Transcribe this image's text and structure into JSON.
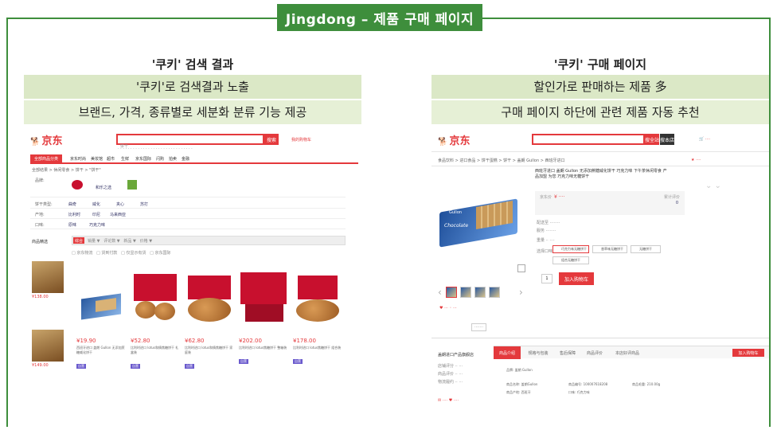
{
  "frame_title": "Jingdong – 제품 구매 페이지",
  "colors": {
    "frame_green": "#3e8e3c",
    "band1": "#dbe8c6",
    "band2": "#e6f0d6",
    "jd_red": "#e4393c"
  },
  "left": {
    "heading": "'쿠키' 검색 결과",
    "band1": "'쿠키'로 검색결과 노출",
    "band2": "브랜드, 가격, 종류별로 세분화 분류 기능 제공",
    "shot": {
      "logo": "京东",
      "search_value": "饼干",
      "search_button": "搜索",
      "cart": "我的购物车",
      "nav_highlight": "全部商品分类",
      "nav_items": [
        "京东时尚",
        "美妆馆",
        "超市",
        "生鲜",
        "京东国际",
        "闪购",
        "拍卖",
        "金融"
      ],
      "breadcrumb": "全部结果 > 休闲零食 > 饼干 > \"饼干\"",
      "filters": [
        {
          "label": "品牌:",
          "options": [
            "lotus",
            "和乐之选"
          ]
        },
        {
          "label": "饼干类型:",
          "options": [
            "曲奇",
            "威化",
            "夹心",
            "苏打"
          ]
        },
        {
          "label": "产地:",
          "options": [
            "比利时",
            "印尼",
            "马来西亚"
          ]
        },
        {
          "label": "口味:",
          "options": [
            "原味",
            "巧克力味"
          ]
        }
      ],
      "sort_label": "综合",
      "side_label": "商品精选",
      "side_prices": [
        "¥138.00",
        "¥149.00"
      ],
      "products": [
        {
          "price": "¥19.90",
          "desc": "西班牙进口 盖朗 Gullon 无添加蔗糖威化饼干"
        },
        {
          "price": "¥52.80",
          "desc": "比利时进口 lotus和情焦糖饼干 礼盒装"
        },
        {
          "price": "¥62.80",
          "desc": "比利时进口 lotus和情焦糖饼干 家庭装"
        },
        {
          "price": "¥202.00",
          "desc": "比利时进口 lotus焦糖饼干 整箱装"
        },
        {
          "price": "¥178.00",
          "desc": "比利时进口 lotus焦糖饼干 组合装"
        }
      ]
    }
  },
  "right": {
    "heading": "'쿠키' 구매 페이지",
    "band1": "할인가로 판매하는 제품 多",
    "band2": "구매 페이지 하단에 관련 제품 자동 추천",
    "shot": {
      "logo": "京东",
      "search_button1": "搜全站",
      "search_button2": "搜本店",
      "breadcrumb": "食品饮料 > 进口食品 > 饼干蛋糕 > 饼干 > 盖朗 Gullon > 西班牙进口",
      "product_title": "西班牙进口 盖朗 Gullon 无添加蔗糖威化饼干 巧克力味 下午茶休闲零食 产品加盟 为您 巧克力味无糖饼干",
      "package_brand": "Gullon",
      "package_label": "Chocolate",
      "variants": [
        "巧克力味无糖饼干",
        "香草味无糖饼干",
        "无糖饼干",
        "组合无糖饼干"
      ],
      "add_to_cart": "加入购物车",
      "tabs": [
        "商品介绍",
        "规格与包装",
        "售后保障",
        "商品评价",
        "本店好评商品"
      ],
      "tab_button": "加入购物车",
      "left_box": "盖朗进口产品旗舰店",
      "specs": [
        "品牌: 盖朗 Gullon",
        "商品名称: 盖朗Gullon",
        "商品编号: 100007618208",
        "商品毛重: 210.00g",
        "商品产地: 西班牙",
        "口味: 巧克力味"
      ]
    }
  }
}
